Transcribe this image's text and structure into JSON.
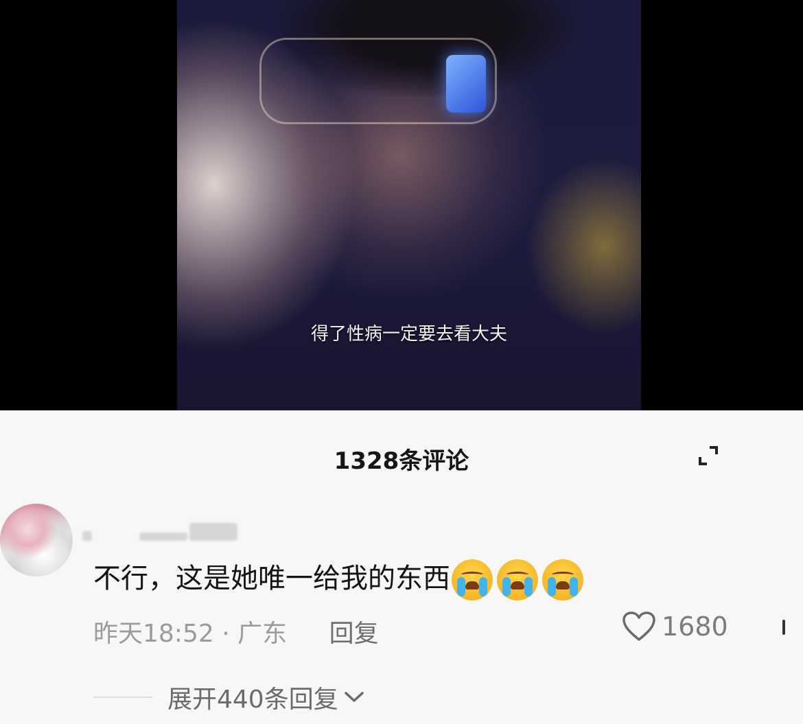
{
  "video": {
    "subtitle": "得了性病一定要去看大夫"
  },
  "comments": {
    "count_label": "1328条评论",
    "items": [
      {
        "text": "不行，这是她唯一给我的东西",
        "emoji": [
          "cry-emoji",
          "cry-emoji",
          "cry-emoji"
        ],
        "time": "昨天18:52",
        "separator": "·",
        "location": "广东",
        "reply_label": "回复",
        "likes": "1680",
        "expand_label": "展开440条回复"
      }
    ]
  },
  "icons": {
    "expand": "expand-icon",
    "heart": "heart-icon",
    "chevron": "chevron-down-icon",
    "more": "more-icon"
  }
}
